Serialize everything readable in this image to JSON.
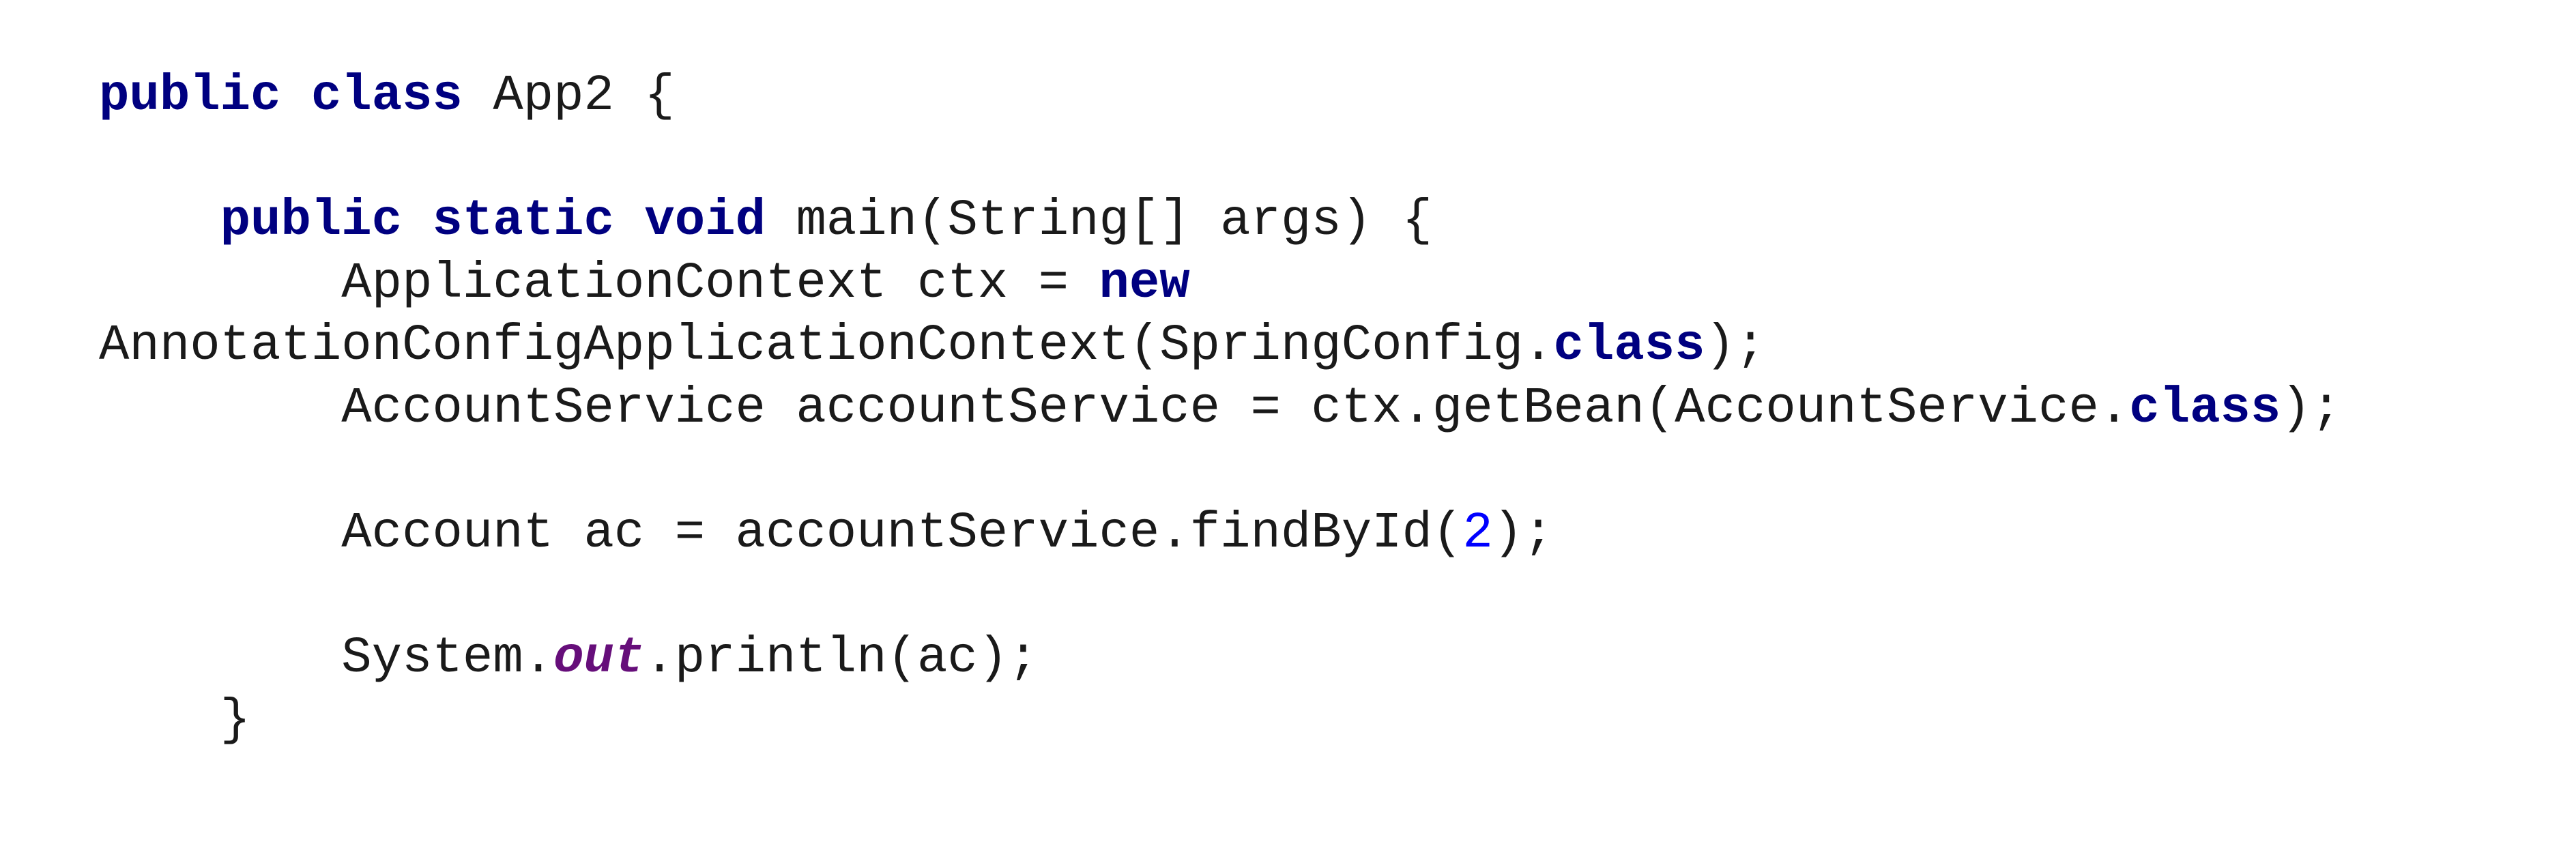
{
  "code": {
    "lines": [
      [
        {
          "text": "public",
          "kind": "keyword"
        },
        {
          "text": " ",
          "kind": "plain"
        },
        {
          "text": "class",
          "kind": "keyword"
        },
        {
          "text": " App2 {",
          "kind": "plain"
        }
      ],
      [],
      [
        {
          "text": "    ",
          "kind": "plain"
        },
        {
          "text": "public",
          "kind": "keyword"
        },
        {
          "text": " ",
          "kind": "plain"
        },
        {
          "text": "static",
          "kind": "keyword"
        },
        {
          "text": " ",
          "kind": "plain"
        },
        {
          "text": "void",
          "kind": "keyword"
        },
        {
          "text": " main(String[] args) {",
          "kind": "plain"
        }
      ],
      [
        {
          "text": "        ApplicationContext ctx = ",
          "kind": "plain"
        },
        {
          "text": "new",
          "kind": "keyword"
        }
      ],
      [
        {
          "text": "AnnotationConfigApplicationContext(SpringConfig.",
          "kind": "plain"
        },
        {
          "text": "class",
          "kind": "keyword"
        },
        {
          "text": ");",
          "kind": "plain"
        }
      ],
      [
        {
          "text": "        AccountService accountService = ctx.getBean(AccountService.",
          "kind": "plain"
        },
        {
          "text": "class",
          "kind": "keyword"
        },
        {
          "text": ");",
          "kind": "plain"
        }
      ],
      [],
      [
        {
          "text": "        Account ac = accountService.findById(",
          "kind": "plain"
        },
        {
          "text": "2",
          "kind": "number"
        },
        {
          "text": ");",
          "kind": "plain"
        }
      ],
      [],
      [
        {
          "text": "        System.",
          "kind": "plain"
        },
        {
          "text": "out",
          "kind": "field"
        },
        {
          "text": ".println(ac);",
          "kind": "plain"
        }
      ],
      [
        {
          "text": "    }",
          "kind": "plain"
        }
      ]
    ]
  },
  "colors": {
    "background": "#ffffff",
    "plain_text": "#1a1a1a",
    "keyword": "#000080",
    "number": "#0000ff",
    "static_field": "#660e7a"
  }
}
